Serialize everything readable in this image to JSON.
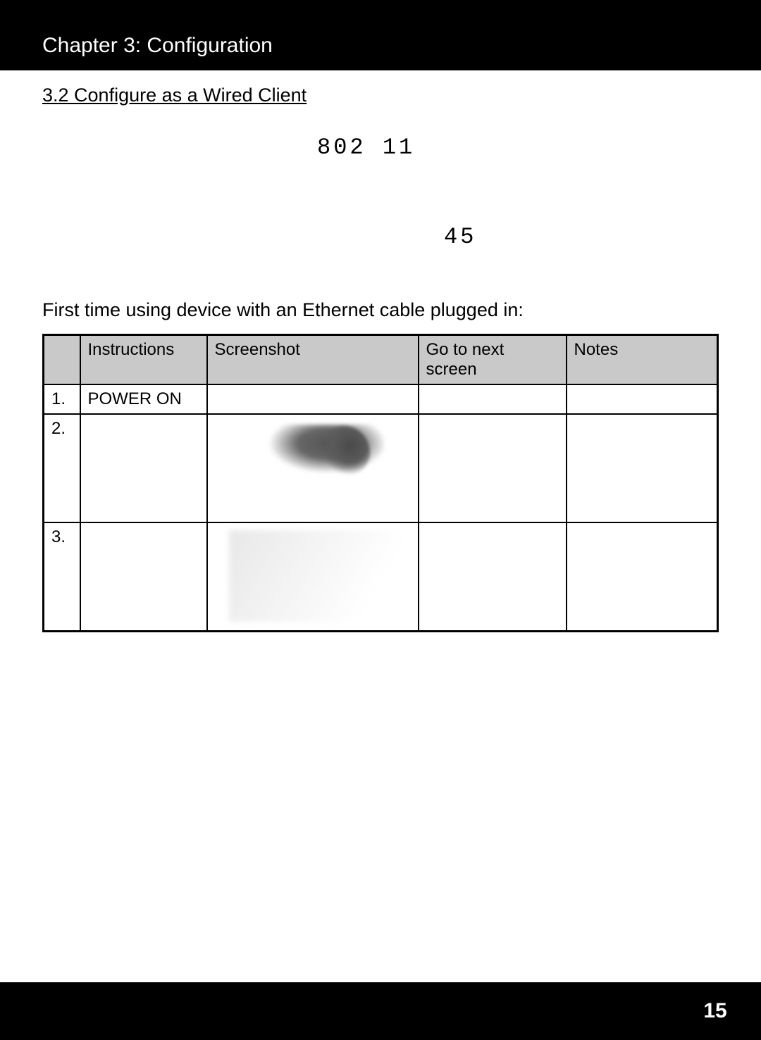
{
  "header": {
    "chapter_title": "Chapter 3: Configuration"
  },
  "section": {
    "heading": "3.2 Configure as a Wired Client",
    "lcd_line1": "802  11",
    "lcd_line2": "45",
    "intro": "First time using device with an Ethernet cable plugged in:"
  },
  "table": {
    "headers": {
      "num": "",
      "instructions": "Instructions",
      "screenshot": "Screenshot",
      "goto": "Go to next screen",
      "notes": "Notes"
    },
    "rows": [
      {
        "num": "1.",
        "instructions": "POWER ON",
        "screenshot": "",
        "goto": "",
        "notes": ""
      },
      {
        "num": "2.",
        "instructions": "",
        "screenshot": "",
        "goto": "",
        "notes": ""
      },
      {
        "num": "3.",
        "instructions": "",
        "screenshot": "",
        "goto": "",
        "notes": ""
      }
    ]
  },
  "footer": {
    "page_number": "15"
  }
}
